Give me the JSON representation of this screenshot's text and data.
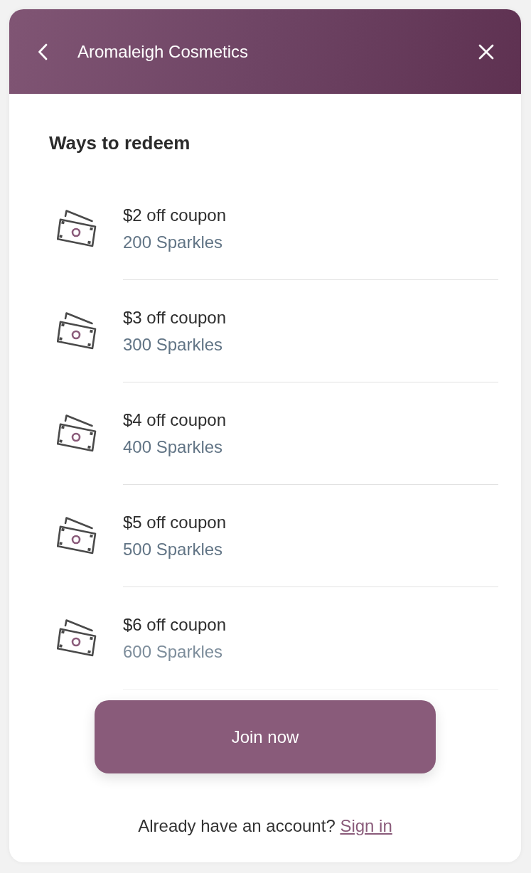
{
  "header": {
    "title": "Aromaleigh Cosmetics"
  },
  "section_title": "Ways to redeem",
  "rewards": [
    {
      "title": "$2 off coupon",
      "cost": "200 Sparkles"
    },
    {
      "title": "$3 off coupon",
      "cost": "300 Sparkles"
    },
    {
      "title": "$4 off coupon",
      "cost": "400 Sparkles"
    },
    {
      "title": "$5 off coupon",
      "cost": "500 Sparkles"
    },
    {
      "title": "$6 off coupon",
      "cost": "600 Sparkles"
    }
  ],
  "primary_button": "Join now",
  "footer": {
    "prompt": "Already have an account?",
    "link": "Sign in"
  }
}
